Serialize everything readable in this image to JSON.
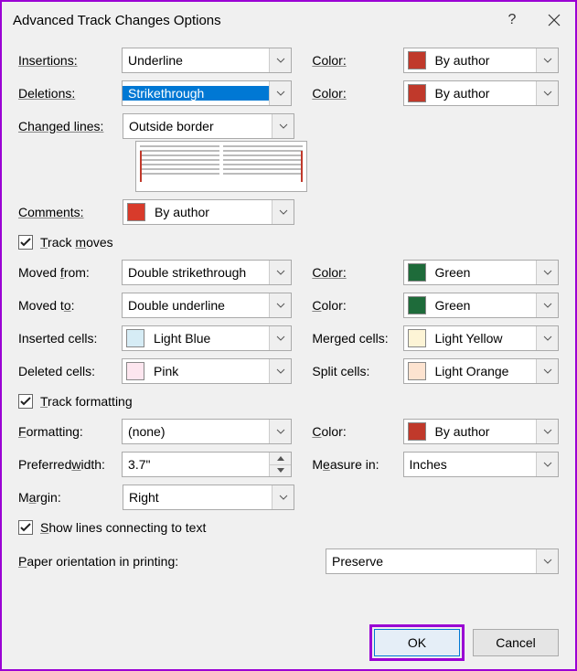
{
  "title": "Advanced Track Changes Options",
  "labels": {
    "insertions": "Insertions:",
    "deletions": "Deletions:",
    "changedLines": "Changed lines:",
    "comments": "Comments:",
    "trackMoves": "Track moves",
    "movedFrom": "Moved from:",
    "movedTo": "Moved to:",
    "insertedCells": "Inserted cells:",
    "deletedCells": "Deleted cells:",
    "mergedCells": "Merged cells:",
    "splitCells": "Split cells:",
    "trackFormatting": "Track formatting",
    "formatting": "Formatting:",
    "preferredWidth": "Preferred width:",
    "measureIn": "Measure in:",
    "margin": "Margin:",
    "showLines": "Show lines connecting to text",
    "paperOrientation": "Paper orientation in printing:",
    "color": "Color:"
  },
  "values": {
    "insertions": "Underline",
    "insertionsColor": "By author",
    "deletions": "Strikethrough",
    "deletionsColor": "By author",
    "changedLines": "Outside border",
    "comments": "By author",
    "movedFrom": "Double strikethrough",
    "movedFromColor": "Green",
    "movedTo": "Double underline",
    "movedToColor": "Green",
    "insertedCells": "Light Blue",
    "deletedCells": "Pink",
    "mergedCells": "Light Yellow",
    "splitCells": "Light Orange",
    "formatting": "(none)",
    "formattingColor": "By author",
    "preferredWidth": "3.7\"",
    "measureIn": "Inches",
    "margin": "Right",
    "paperOrientation": "Preserve"
  },
  "swatches": {
    "byAuthorRed": "#c0392b",
    "green": "#1e6b3a",
    "lightBlue": "#d6ecf5",
    "pink": "#fde6ef",
    "lightYellow": "#fdf4d6",
    "lightOrange": "#fde3d0",
    "commentsRed": "#d83b2b"
  },
  "buttons": {
    "ok": "OK",
    "cancel": "Cancel"
  }
}
